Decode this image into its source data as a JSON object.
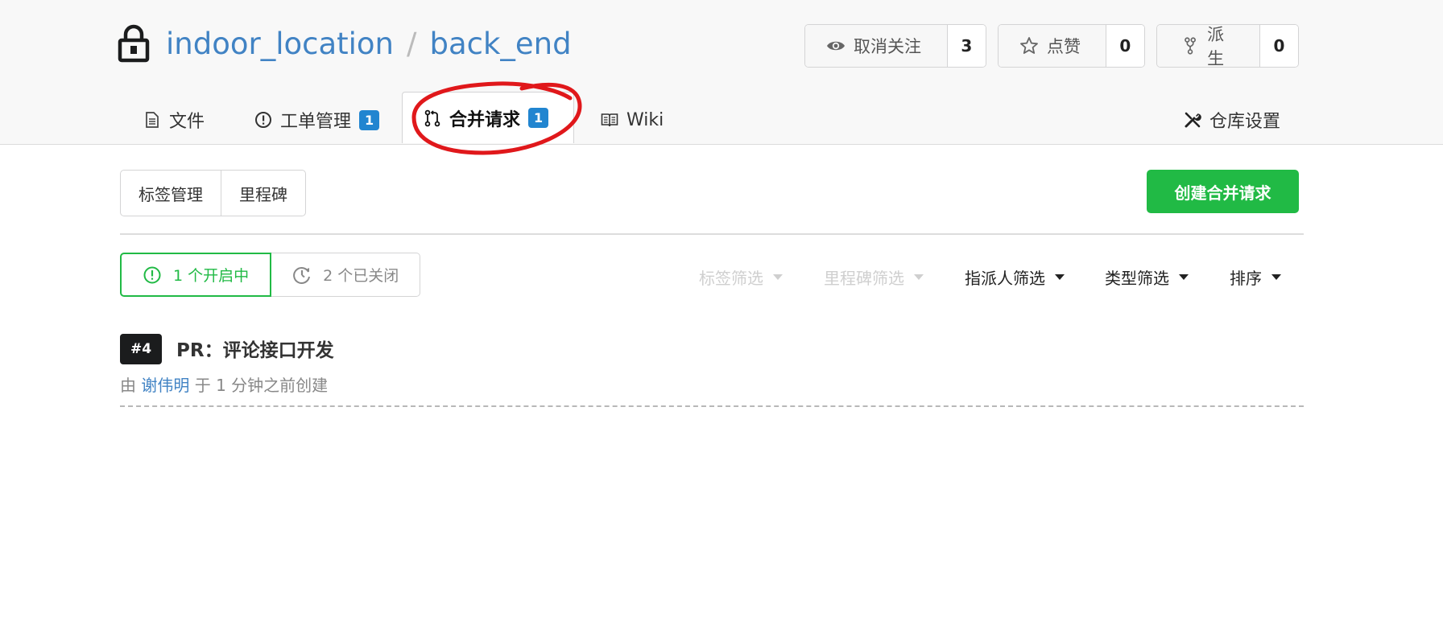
{
  "repo": {
    "owner": "indoor_location",
    "separator": "/",
    "name": "back_end"
  },
  "actions": {
    "watch": {
      "label": "取消关注",
      "count": "3"
    },
    "star": {
      "label": "点赞",
      "count": "0"
    },
    "fork": {
      "label": "派生",
      "count": "0"
    }
  },
  "tabs": {
    "files": {
      "label": "文件"
    },
    "issues": {
      "label": "工单管理",
      "badge": "1"
    },
    "pulls": {
      "label": "合并请求",
      "badge": "1"
    },
    "wiki": {
      "label": "Wiki"
    },
    "settings": {
      "label": "仓库设置"
    }
  },
  "toolbar": {
    "labels": "标签管理",
    "milestones": "里程碑",
    "create_pr": "创建合并请求"
  },
  "state": {
    "open": "1 个开启中",
    "closed": "2 个已关闭"
  },
  "filters": {
    "label": "标签筛选",
    "milestone": "里程碑筛选",
    "assignee": "指派人筛选",
    "type": "类型筛选",
    "sort": "排序"
  },
  "pulls": [
    {
      "number": "#4",
      "title": "PR：评论接口开发",
      "meta_prefix": "由",
      "author": "谢伟明",
      "meta_suffix": "于 1 分钟之前创建"
    }
  ],
  "colors": {
    "link": "#4183c4",
    "green": "#21ba45",
    "badge_blue": "#2185d0",
    "annotation_red": "#e0181b"
  }
}
